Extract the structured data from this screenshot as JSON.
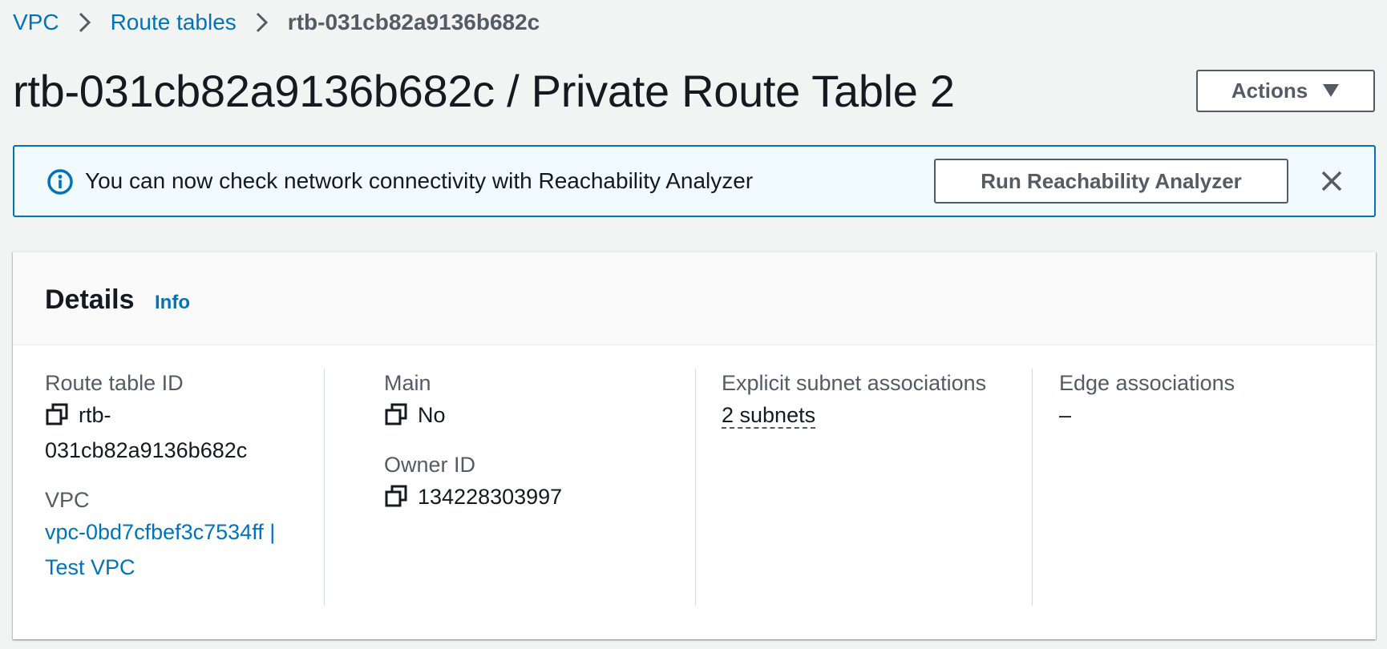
{
  "breadcrumb": {
    "vpc": "VPC",
    "route_tables": "Route tables",
    "current": "rtb-031cb82a9136b682c"
  },
  "page_title": "rtb-031cb82a9136b682c / Private Route Table 2",
  "actions_label": "Actions",
  "banner": {
    "message": "You can now check network connectivity with Reachability Analyzer",
    "button_label": "Run Reachability Analyzer"
  },
  "details": {
    "title": "Details",
    "info_label": "Info",
    "route_table_id": {
      "label": "Route table ID",
      "value_line1": "rtb-",
      "value_line2": "031cb82a9136b682c"
    },
    "vpc": {
      "label": "VPC",
      "value_line1": "vpc-0bd7cfbef3c7534ff |",
      "value_line2": "Test VPC"
    },
    "main": {
      "label": "Main",
      "value": "No"
    },
    "owner_id": {
      "label": "Owner ID",
      "value": "134228303997"
    },
    "explicit_subnet_associations": {
      "label": "Explicit subnet associations",
      "value": "2 subnets"
    },
    "edge_associations": {
      "label": "Edge associations",
      "value": "–"
    }
  },
  "colors": {
    "link": "#0073bb",
    "text": "#16191f",
    "secondary_text": "#545b64",
    "banner_bg": "#f1faff",
    "page_bg": "#f2f3f3"
  },
  "icons": [
    "chevron-right-icon",
    "caret-down-icon",
    "info-circle-icon",
    "close-icon",
    "copy-icon"
  ]
}
